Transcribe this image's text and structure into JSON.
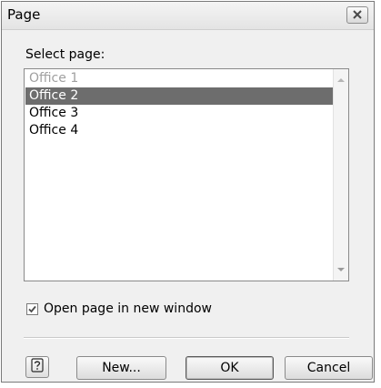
{
  "window": {
    "title": "Page",
    "close_icon": "close-icon"
  },
  "content": {
    "select_label": "Select page:",
    "pages": [
      {
        "label": "Office 1",
        "state": "disabled"
      },
      {
        "label": "Office 2",
        "state": "selected"
      },
      {
        "label": "Office 3",
        "state": "normal"
      },
      {
        "label": "Office 4",
        "state": "normal"
      }
    ],
    "open_in_new_window": {
      "label": "Open page in new window",
      "checked": true
    }
  },
  "buttons": {
    "help_icon": "help-icon",
    "new_label": "New...",
    "ok_label": "OK",
    "cancel_label": "Cancel"
  }
}
